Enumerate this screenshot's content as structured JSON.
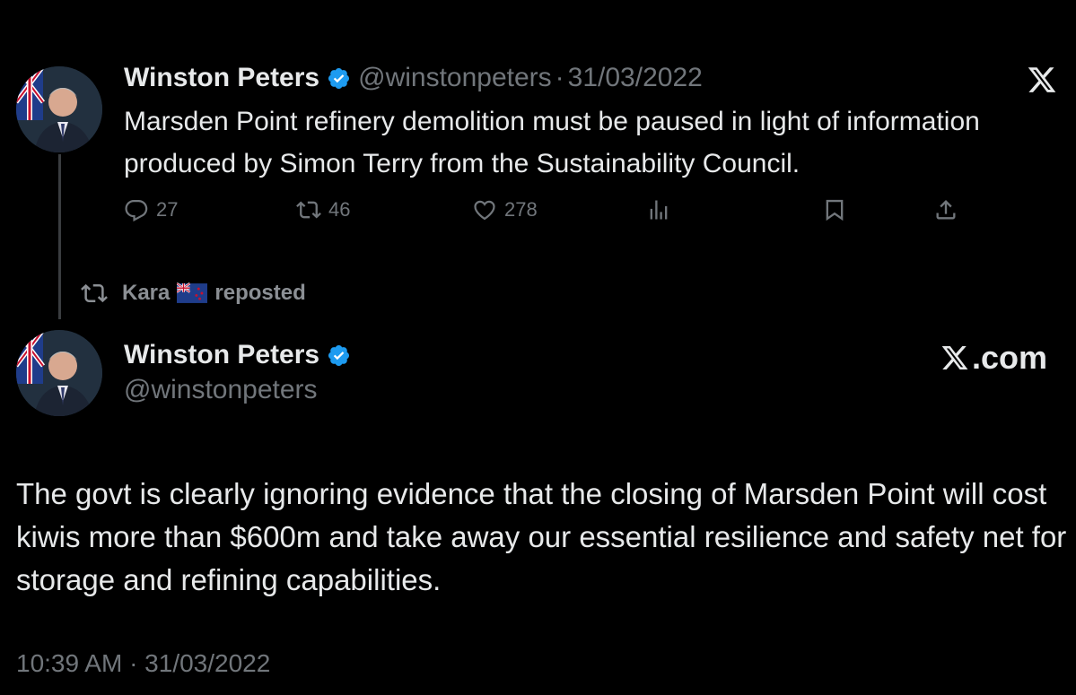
{
  "colors": {
    "background": "#000000",
    "text": "#e7e9ea",
    "muted": "#71767b",
    "verified": "#1d9bf0"
  },
  "tweet1": {
    "name": "Winston Peters",
    "handle": "@winstonpeters",
    "separator": "·",
    "date": "31/03/2022",
    "text": "Marsden Point refinery demolition must be paused in light of information produced by Simon Terry from the Sustainability Council.",
    "actions": {
      "replies": "27",
      "reposts": "46",
      "likes": "278"
    }
  },
  "repost_line": {
    "user": "Kara",
    "label": "reposted"
  },
  "tweet2": {
    "name": "Winston Peters",
    "handle": "@winstonpeters",
    "brand": ".com",
    "text": "The govt is clearly ignoring evidence that the closing of Marsden Point will cost kiwis more than $600m and take away our  essential resilience and safety net for storage and refining capabilities.",
    "timestamp": "10:39 AM · 31/03/2022"
  },
  "icons": [
    "verified-icon",
    "x-logo-icon",
    "reply-icon",
    "repost-icon",
    "like-icon",
    "views-icon",
    "bookmark-icon",
    "share-icon",
    "nz-flag-icon"
  ]
}
